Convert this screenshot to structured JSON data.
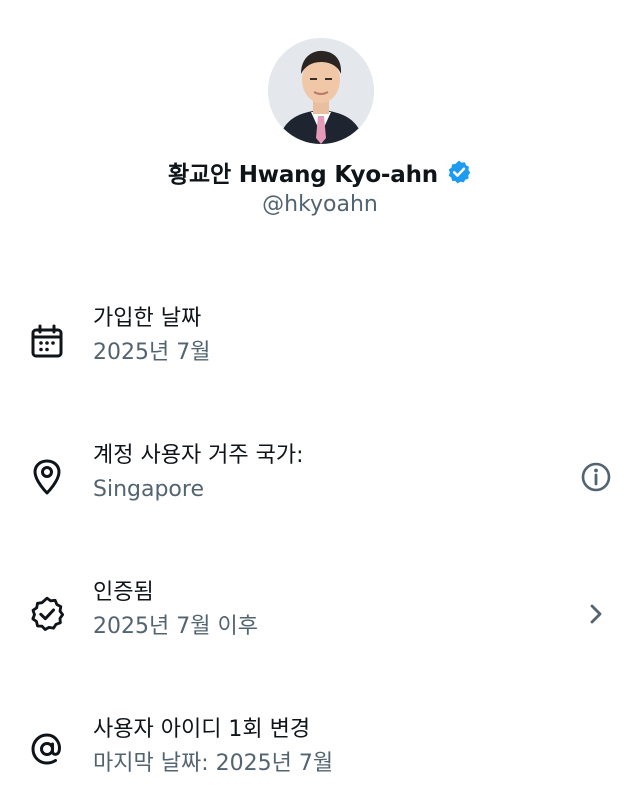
{
  "profile": {
    "display_name": "황교안 Hwang Kyo-ahn",
    "handle": "@hkyoahn",
    "verified": true,
    "badge_color": "#1d9bf0"
  },
  "rows": [
    {
      "icon": "calendar-icon",
      "label": "가입한 날짜",
      "value": "2025년 7월"
    },
    {
      "icon": "location-pin-icon",
      "label": "계정 사용자 거주 국가:",
      "value": "Singapore",
      "trailing_icon": "info-circle-icon"
    },
    {
      "icon": "verified-check-icon",
      "label": "인증됨",
      "value": "2025년 7월 이후",
      "trailing_icon": "chevron-right-icon"
    },
    {
      "icon": "at-sign-icon",
      "label": "사용자 아이디 1회 변경",
      "value": "마지막 날짜: 2025년 7월"
    }
  ],
  "colors": {
    "primary_text": "#0f1419",
    "secondary_text": "#536471"
  }
}
